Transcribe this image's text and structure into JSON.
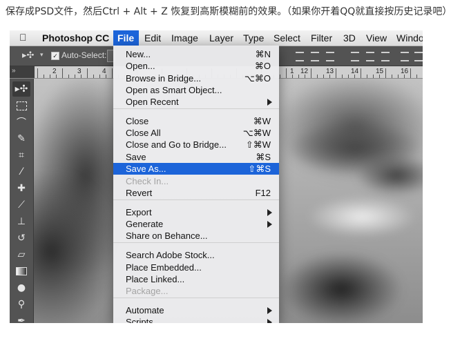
{
  "caption": "保存成PSD文件，然后Ctrl + Alt + Z 恢复到高斯模糊前的效果。（如果你开着QQ就直接按历史记录吧）",
  "menubar": {
    "app": "Photoshop CC",
    "items": [
      "File",
      "Edit",
      "Image",
      "Layer",
      "Type",
      "Select",
      "Filter",
      "3D",
      "View",
      "Windo"
    ]
  },
  "options_bar": {
    "auto_select_label": "Auto-Select:",
    "checkbox_mark": "✓"
  },
  "ruler": {
    "labels": [
      "2",
      "3",
      "4",
      "1",
      "12",
      "13",
      "14",
      "15",
      "16"
    ]
  },
  "file_menu": {
    "groups": [
      [
        {
          "label": "New...",
          "shortcut": "⌘N"
        },
        {
          "label": "Open...",
          "shortcut": "⌘O"
        },
        {
          "label": "Browse in Bridge...",
          "shortcut": "⌥⌘O"
        },
        {
          "label": "Open as Smart Object...",
          "shortcut": ""
        },
        {
          "label": "Open Recent",
          "shortcut": "",
          "submenu": true
        }
      ],
      [
        {
          "label": "Close",
          "shortcut": "⌘W"
        },
        {
          "label": "Close All",
          "shortcut": "⌥⌘W"
        },
        {
          "label": "Close and Go to Bridge...",
          "shortcut": "⇧⌘W"
        },
        {
          "label": "Save",
          "shortcut": "⌘S"
        },
        {
          "label": "Save As...",
          "shortcut": "⇧⌘S",
          "highlighted": true
        },
        {
          "label": "Check In...",
          "shortcut": "",
          "disabled": true
        },
        {
          "label": "Revert",
          "shortcut": "F12"
        }
      ],
      [
        {
          "label": "Export",
          "shortcut": "",
          "submenu": true
        },
        {
          "label": "Generate",
          "shortcut": "",
          "submenu": true
        },
        {
          "label": "Share on Behance...",
          "shortcut": ""
        }
      ],
      [
        {
          "label": "Search Adobe Stock...",
          "shortcut": ""
        },
        {
          "label": "Place Embedded...",
          "shortcut": ""
        },
        {
          "label": "Place Linked...",
          "shortcut": ""
        },
        {
          "label": "Package...",
          "shortcut": "",
          "disabled": true
        }
      ],
      [
        {
          "label": "Automate",
          "shortcut": "",
          "submenu": true
        },
        {
          "label": "Scripts",
          "shortcut": "",
          "submenu": true
        }
      ]
    ]
  },
  "colors": {
    "highlight": "#1c64d9",
    "panel": "#535353"
  }
}
